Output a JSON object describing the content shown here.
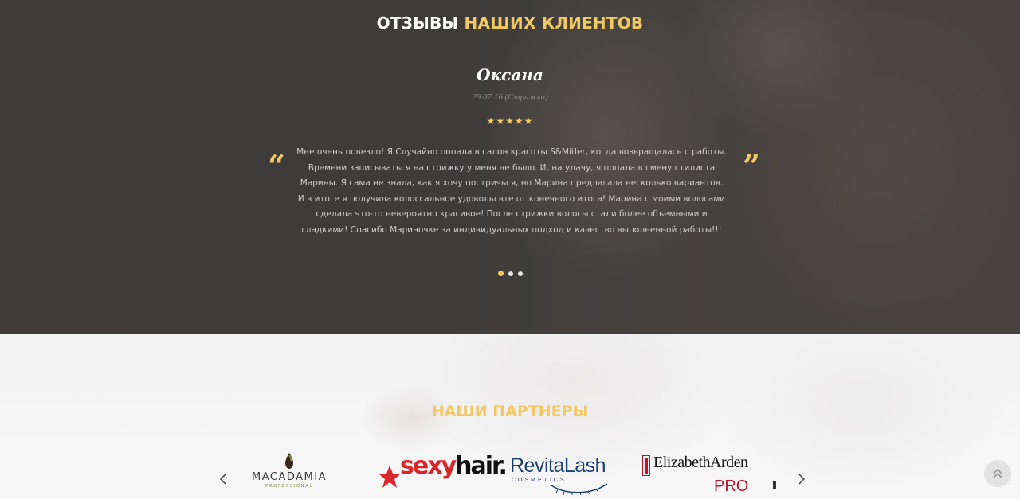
{
  "reviews": {
    "title_white": "ОТЗЫВЫ",
    "title_yellow": "НАШИХ КЛИЕНТОВ",
    "review": {
      "name": "Оксана",
      "meta": "29.07.16 (Стрижка)",
      "stars": "★★★★★",
      "rating": 5,
      "quote_open": "“",
      "quote_close": "”",
      "text": "Мне очень повезло! Я Случайно попала в салон красоты S&Mitler, когда возвращалась с работы. Времени записываться на стрижку у меня не было. И, на удачу, я попала в смену стилиста Марины. Я сама не знала, как я хочу постричься, но Марина предлагала несколько вариантов. И в итоге я получила колоссальное удовольсвте от конечного итога! Марина с моими волосами сделала что-то невероятно красивое! После стрижки волосы стали более объемными и гладкими! Спасибо Мариночке за индивидуальных подход и качество выполненной работы!!!"
    },
    "dots_active": 0,
    "dots_count": 3
  },
  "partners": {
    "title": "НАШИ ПАРТНЕРЫ",
    "logos": {
      "macadamia": {
        "name": "MACADAMIA",
        "sub": "PROFESSIONAL"
      },
      "sexyhair": {
        "sexy": "sexy",
        "hair": "hair."
      },
      "revitalash": {
        "name": "RevitaLash",
        "sub": "COSMETICS"
      },
      "elizabeth_arden": {
        "name": "ElizabethArden",
        "pro": "PRO"
      }
    },
    "icons": {
      "prev": "chevron-left-icon",
      "next": "chevron-right-icon",
      "scroll_top": "double-chevron-up-icon"
    }
  },
  "colors": {
    "accent": "#f2c862",
    "review_text": "#cfcbc7",
    "meta_text": "#8e8a86"
  }
}
